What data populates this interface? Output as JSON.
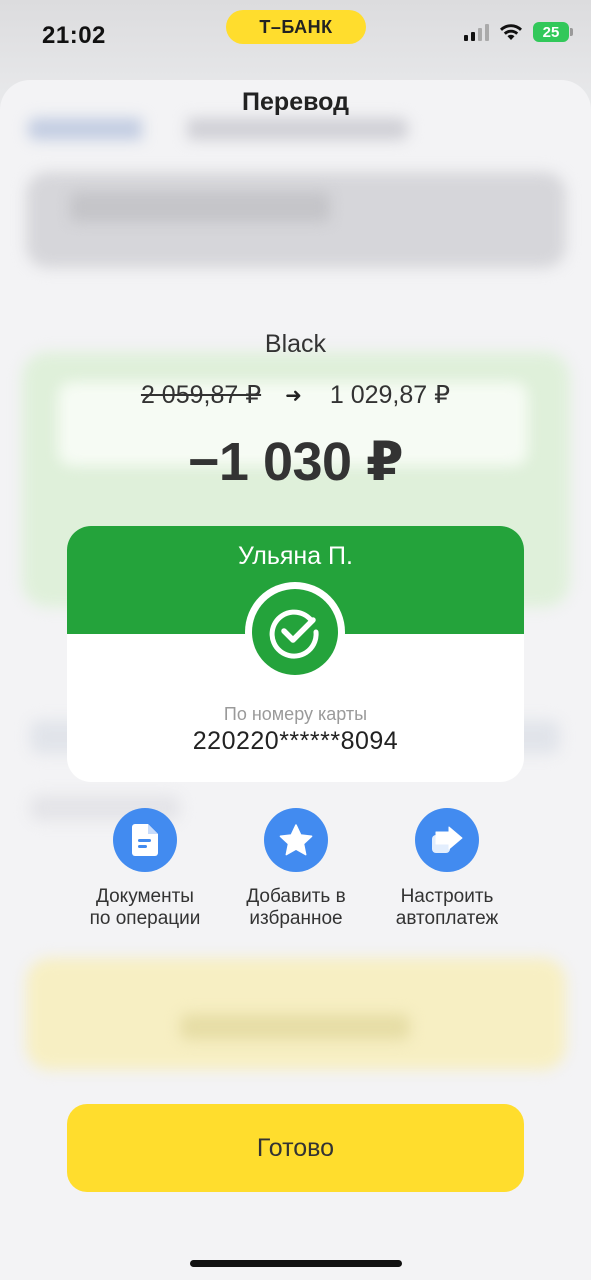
{
  "status_bar": {
    "time": "21:02",
    "bank_name": "Т–БАНК",
    "battery": "25"
  },
  "header": {
    "title": "Перевод"
  },
  "transfer": {
    "account_name": "Black",
    "old_balance": "2 059,87 ₽",
    "new_balance": "1 029,87 ₽",
    "amount": "−1 030 ₽"
  },
  "recipient": {
    "name": "Ульяна П.",
    "method": "По номеру карты",
    "card_number": "220220******8094",
    "brand_color": "#24a33b"
  },
  "actions": [
    {
      "label": "Документы\nпо операции",
      "icon": "document-icon"
    },
    {
      "label": "Добавить в\nизбранное",
      "icon": "star-icon"
    },
    {
      "label": "Настроить\nавтоплатеж",
      "icon": "share-arrow-icon"
    }
  ],
  "done_button": {
    "label": "Готово",
    "color": "#ffdd2d"
  },
  "colors": {
    "accent_blue": "#428bf0",
    "brand_yellow": "#ffdd2d",
    "success_green": "#24a33b"
  }
}
